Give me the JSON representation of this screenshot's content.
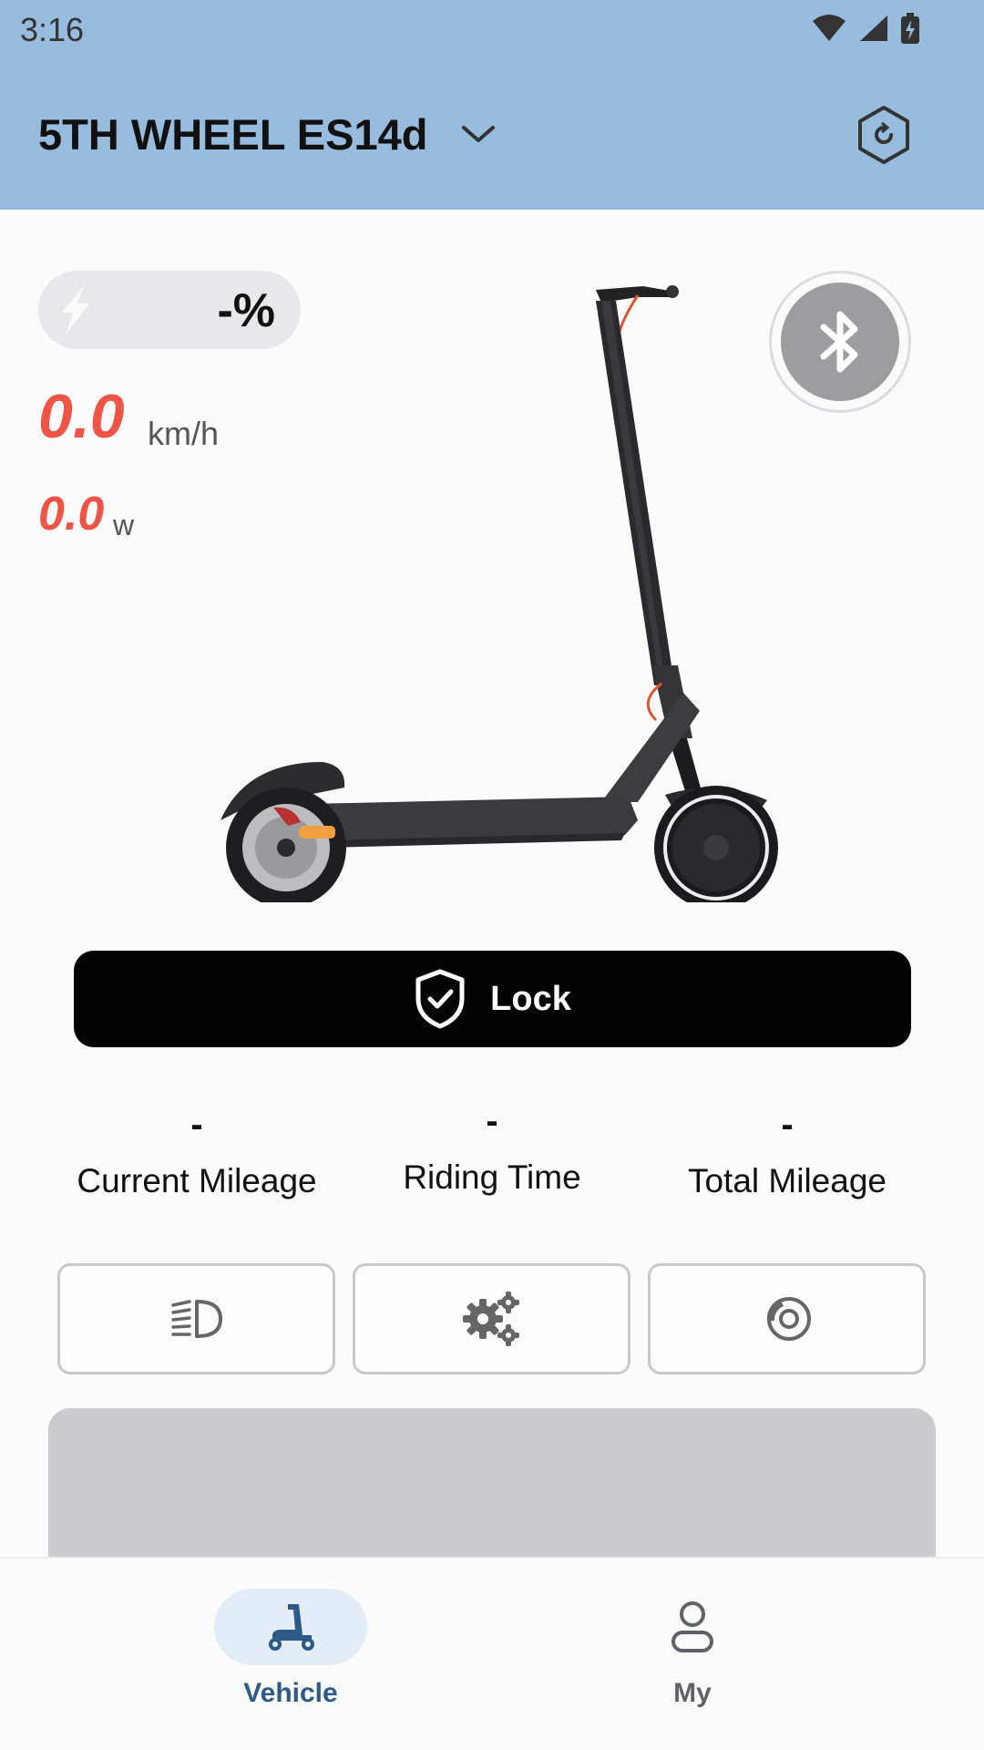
{
  "status_bar": {
    "time": "3:16"
  },
  "header": {
    "device_name": "5TH WHEEL ES14d"
  },
  "battery": {
    "percent_text": "-%"
  },
  "speed": {
    "value": "0.0",
    "unit": "km/h"
  },
  "power": {
    "value": "0.0",
    "unit": "w"
  },
  "lock_button": {
    "label": "Lock"
  },
  "stats": [
    {
      "value": "-",
      "label": "Current Mileage"
    },
    {
      "value": "-",
      "label": "Riding Time"
    },
    {
      "value": "-",
      "label": "Total Mileage"
    }
  ],
  "nav": [
    {
      "label": "Vehicle",
      "active": true
    },
    {
      "label": "My",
      "active": false
    }
  ],
  "colors": {
    "header_bg": "#97bcdd",
    "accent_red": "#ef5546",
    "nav_active": "#2e5a86",
    "nav_inactive": "#5f6368"
  }
}
